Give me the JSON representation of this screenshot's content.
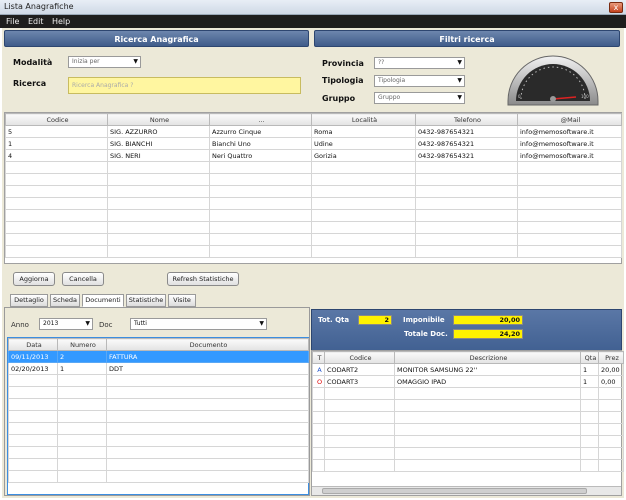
{
  "window": {
    "title": "Lista Anagrafiche",
    "close_label": "x"
  },
  "menu": [
    "File",
    "Edit",
    "Help"
  ],
  "ricerca": {
    "header": "Ricerca Anagrafica",
    "modalita_label": "Modalità",
    "modalita_value": "Inizia per",
    "ricerca_label": "Ricerca",
    "ricerca_placeholder": "Ricerca Anagrafica ?"
  },
  "filtri": {
    "header": "Filtri ricerca",
    "provincia_label": "Provincia",
    "provincia_value": "??",
    "tipologia_label": "Tipologia",
    "tipologia_value": "Tipologia",
    "gruppo_label": "Gruppo",
    "gruppo_value": "Gruppo"
  },
  "gauge": {
    "min_label": "0",
    "max_label": "100"
  },
  "main_table": {
    "columns": [
      "Codice",
      "Nome",
      "...",
      "Località",
      "Telefono",
      "@Mail"
    ],
    "rows": [
      [
        "5",
        "SIG. AZZURRO",
        "Azzurro Cinque",
        "Roma",
        "0432-987654321",
        "info@memosoftware.it"
      ],
      [
        "1",
        "SIG. BIANCHI",
        "Bianchi Uno",
        "Udine",
        "0432-987654321",
        "info@memosoftware.it"
      ],
      [
        "4",
        "SIG. NERI",
        "Neri Quattro",
        "Gorizia",
        "0432-987654321",
        "info@memosoftware.it"
      ]
    ]
  },
  "buttons": {
    "aggiorna": "Aggiorna",
    "cancella": "Cancella",
    "refresh_stat": "Refresh Statistiche"
  },
  "tabs": [
    "Dettaglio",
    "Scheda",
    "Documenti",
    "Statistiche",
    "Visite"
  ],
  "docs": {
    "anno_label": "Anno",
    "anno_value": "2013",
    "doc_label": "Doc",
    "doc_value": "Tutti",
    "columns": [
      "Data",
      "Numero",
      "Documento"
    ],
    "rows": [
      [
        "09/11/2013",
        "2",
        "FATTURA"
      ],
      [
        "02/20/2013",
        "1",
        "DDT"
      ]
    ]
  },
  "totals": {
    "tot_qta_label": "Tot. Qta",
    "tot_qta_value": "2",
    "imponibile_label": "Imponibile",
    "imponibile_value": "20,00",
    "totale_label": "Totale Doc.",
    "totale_value": "24,20"
  },
  "detail": {
    "columns": [
      "T",
      "Codice",
      "Descrizione",
      "Qta",
      "Prez"
    ],
    "rows": [
      [
        "A",
        "CODART2",
        "MONITOR SAMSUNG 22''",
        "1",
        "20,00"
      ],
      [
        "O",
        "CODART3",
        "OMAGGIO IPAD",
        "1",
        "0,00"
      ]
    ]
  }
}
